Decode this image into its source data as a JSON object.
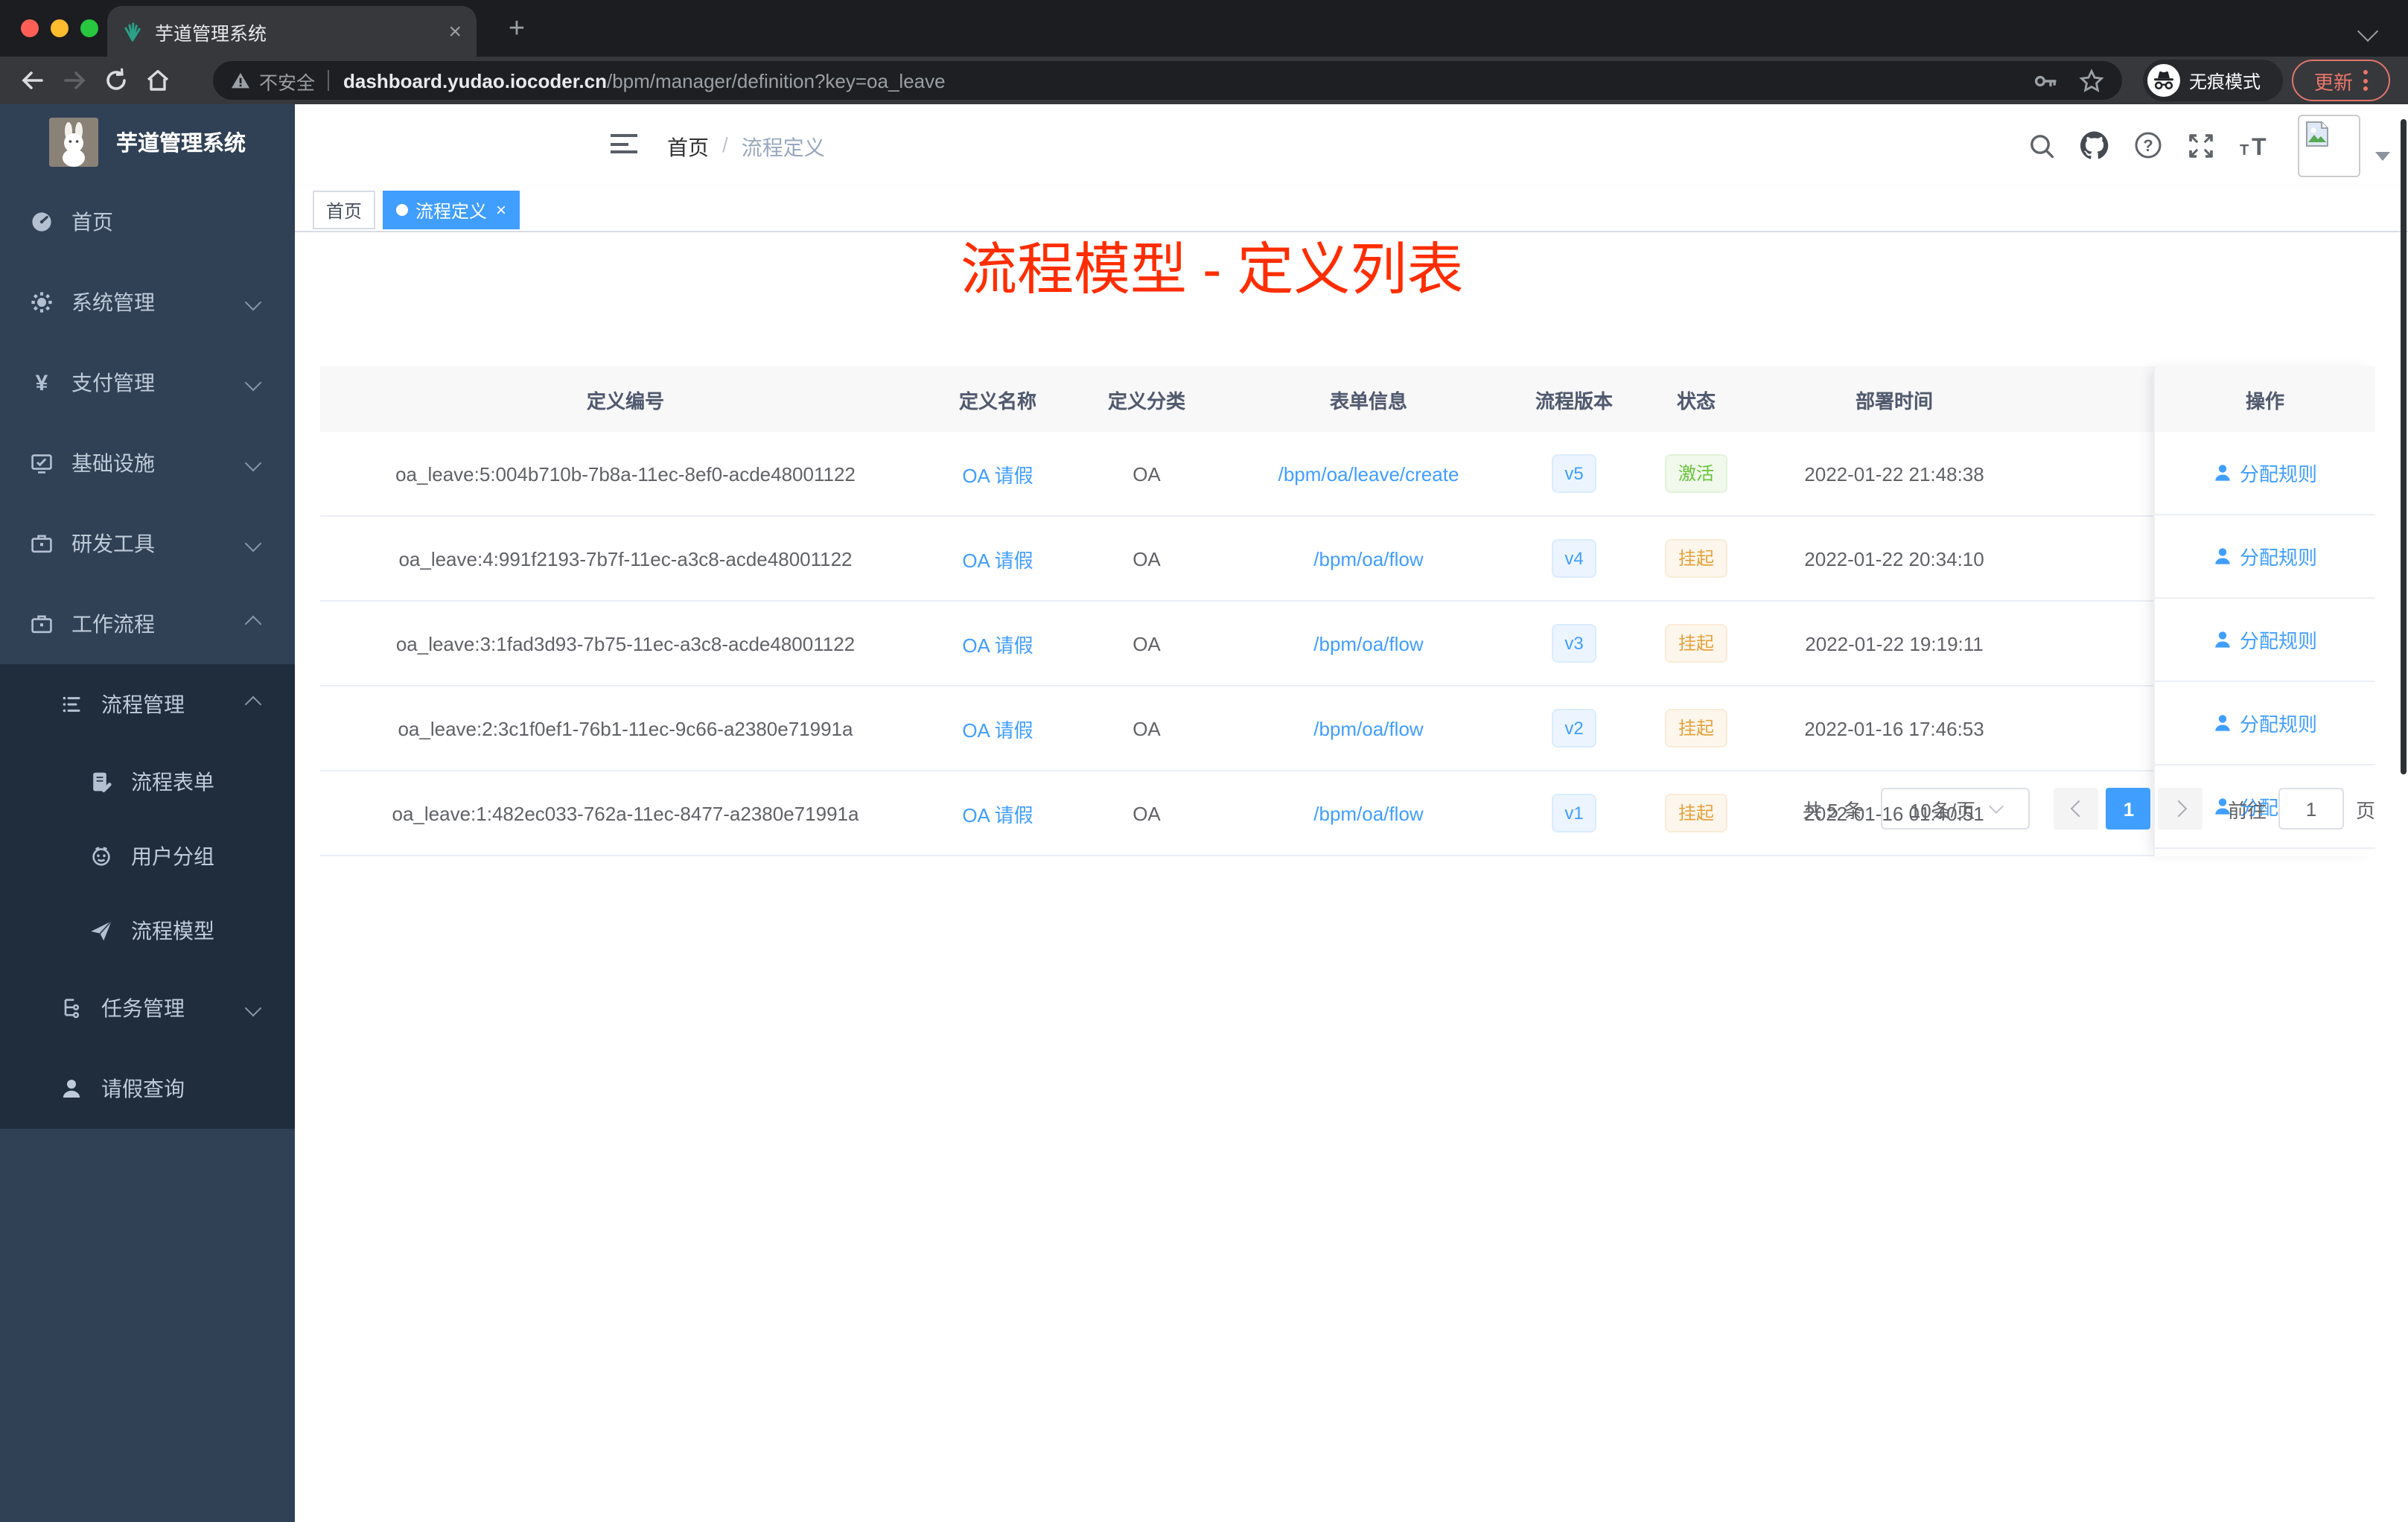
{
  "browser": {
    "tab_title": "芋道管理系统",
    "tab_close": "×",
    "new_tab": "+",
    "security_label": "不安全",
    "url_host": "dashboard.yudao.iocoder.cn",
    "url_path": "/bpm/manager/definition?key=oa_leave",
    "incognito_label": "无痕模式",
    "update_label": "更新"
  },
  "sidebar": {
    "logo_title": "芋道管理系统",
    "items": [
      {
        "label": "首页",
        "icon": "dashboard-icon"
      },
      {
        "label": "系统管理",
        "icon": "gear-icon"
      },
      {
        "label": "支付管理",
        "icon": "yen-icon"
      },
      {
        "label": "基础设施",
        "icon": "monitor-icon"
      },
      {
        "label": "研发工具",
        "icon": "briefcase-icon"
      },
      {
        "label": "工作流程",
        "icon": "briefcase-icon"
      },
      {
        "label": "流程管理",
        "icon": "list-icon"
      },
      {
        "label": "流程表单",
        "icon": "form-icon"
      },
      {
        "label": "用户分组",
        "icon": "user-group-icon"
      },
      {
        "label": "流程模型",
        "icon": "paper-plane-icon"
      },
      {
        "label": "任务管理",
        "icon": "tree-icon"
      },
      {
        "label": "请假查询",
        "icon": "person-icon"
      }
    ]
  },
  "header": {
    "breadcrumb": [
      "首页",
      "流程定义"
    ]
  },
  "tags": {
    "items": [
      {
        "label": "首页",
        "active": false
      },
      {
        "label": "流程定义",
        "active": true
      }
    ]
  },
  "annotation": "流程模型 - 定义列表",
  "table": {
    "columns": [
      "定义编号",
      "定义名称",
      "定义分类",
      "表单信息",
      "流程版本",
      "状态",
      "部署时间",
      "操作"
    ],
    "rows": [
      {
        "id": "oa_leave:5:004b710b-7b8a-11ec-8ef0-acde48001122",
        "name": "OA 请假",
        "category": "OA",
        "form": "/bpm/oa/leave/create",
        "version": "v5",
        "status": "激活",
        "time": "2022-01-22 21:48:38",
        "action": "分配规则"
      },
      {
        "id": "oa_leave:4:991f2193-7b7f-11ec-a3c8-acde48001122",
        "name": "OA 请假",
        "category": "OA",
        "form": "/bpm/oa/flow",
        "version": "v4",
        "status": "挂起",
        "time": "2022-01-22 20:34:10",
        "action": "分配规则"
      },
      {
        "id": "oa_leave:3:1fad3d93-7b75-11ec-a3c8-acde48001122",
        "name": "OA 请假",
        "category": "OA",
        "form": "/bpm/oa/flow",
        "version": "v3",
        "status": "挂起",
        "time": "2022-01-22 19:19:11",
        "action": "分配规则"
      },
      {
        "id": "oa_leave:2:3c1f0ef1-76b1-11ec-9c66-a2380e71991a",
        "name": "OA 请假",
        "category": "OA",
        "form": "/bpm/oa/flow",
        "version": "v2",
        "status": "挂起",
        "time": "2022-01-16 17:46:53",
        "action": "分配规则"
      },
      {
        "id": "oa_leave:1:482ec033-762a-11ec-8477-a2380e71991a",
        "name": "OA 请假",
        "category": "OA",
        "form": "/bpm/oa/flow",
        "version": "v1",
        "status": "挂起",
        "time": "2022-01-16 01:40:51",
        "action": "分配规则"
      }
    ]
  },
  "pagination": {
    "total": "共 5 条",
    "page_size": "10条/页",
    "current_page": "1",
    "goto_label": "前往",
    "goto_value": "1",
    "unit_label": "页"
  },
  "colors": {
    "accent_blue": "#409eff",
    "sidebar_bg": "#304156",
    "submenu_bg": "#1f2d3d",
    "annotation_red": "#ff2d00",
    "status_active_green": "#67c23a",
    "status_suspend_orange": "#e6a23c"
  }
}
